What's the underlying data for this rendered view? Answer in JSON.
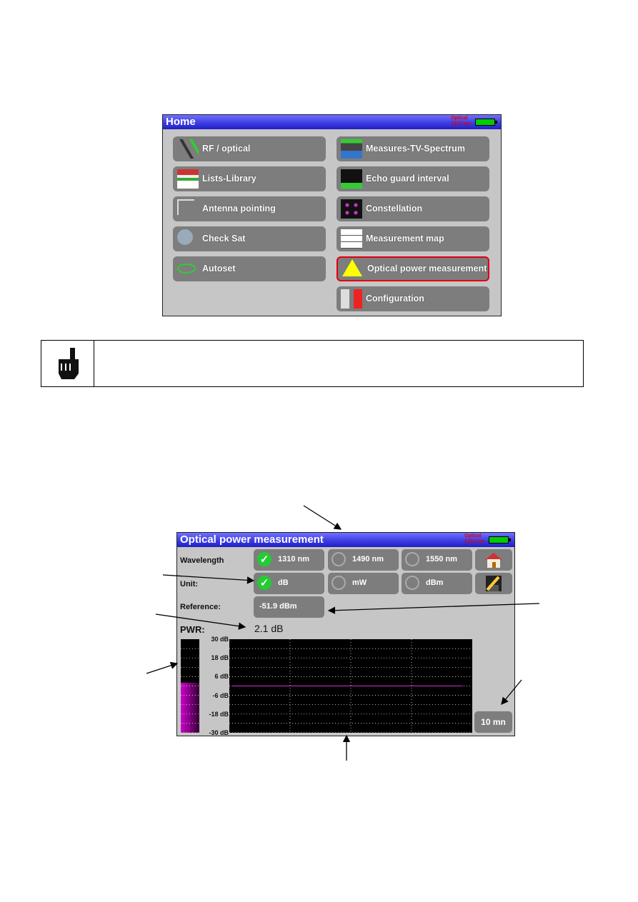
{
  "home_screen": {
    "title": "Home",
    "status": [
      "Optical",
      "1310 nm"
    ],
    "left_buttons": [
      {
        "label": "RF / optical",
        "icon": "connectors-icon"
      },
      {
        "label": "Lists-Library",
        "icon": "books-icon"
      },
      {
        "label": "Antenna pointing",
        "icon": "antenna-icon"
      },
      {
        "label": "Check Sat",
        "icon": "satellite-dish-icon"
      },
      {
        "label": "Autoset",
        "icon": "autoset-icon"
      }
    ],
    "right_buttons": [
      {
        "label": "Measures-TV-Spectrum",
        "icon": "tv-spectrum-icon"
      },
      {
        "label": "Echo guard interval",
        "icon": "echo-icon"
      },
      {
        "label": "Constellation",
        "icon": "constellation-icon"
      },
      {
        "label": "Measurement map",
        "icon": "measurement-map-icon"
      },
      {
        "label": "Optical power measurement",
        "icon": "laser-warning-icon",
        "selected": true
      },
      {
        "label": "Configuration",
        "icon": "configuration-icon"
      }
    ],
    "highlight_color": "#e00010"
  },
  "note": {
    "icon": "pointing-hand-icon",
    "text": ""
  },
  "optical_screen": {
    "title": "Optical power measurement",
    "status": [
      "Optical",
      "1310 nm"
    ],
    "wavelength_label": "Wavelength",
    "wavelengths": [
      {
        "label": "1310 nm",
        "checked": true
      },
      {
        "label": "1490 nm",
        "checked": false
      },
      {
        "label": "1550 nm",
        "checked": false
      }
    ],
    "unit_label": "Unit:",
    "units": [
      {
        "label": "dB",
        "checked": true
      },
      {
        "label": "mW",
        "checked": false
      },
      {
        "label": "dBm",
        "checked": false
      }
    ],
    "reference_label": "Reference:",
    "reference_value": "-51.9 dBm",
    "pwr_label": "PWR:",
    "pwr_value": "2.1 dB",
    "time_button": "10 mn",
    "home_icon": "home-icon",
    "save_icon": "save-edit-icon"
  },
  "chart_data": {
    "type": "line",
    "yticks": [
      "30 dB",
      "18 dB",
      "6 dB",
      "-6 dB",
      "-18 dB",
      "-30 dB"
    ],
    "ylim": [
      -30,
      30
    ],
    "grid": true,
    "series": [
      {
        "values": [
          0,
          0,
          0,
          0,
          0,
          0,
          0,
          0,
          0,
          0,
          0,
          0,
          0,
          0,
          0,
          0,
          0,
          0,
          0,
          0
        ],
        "color": "#cc33cc"
      }
    ],
    "bar_level_db": 2.1
  }
}
